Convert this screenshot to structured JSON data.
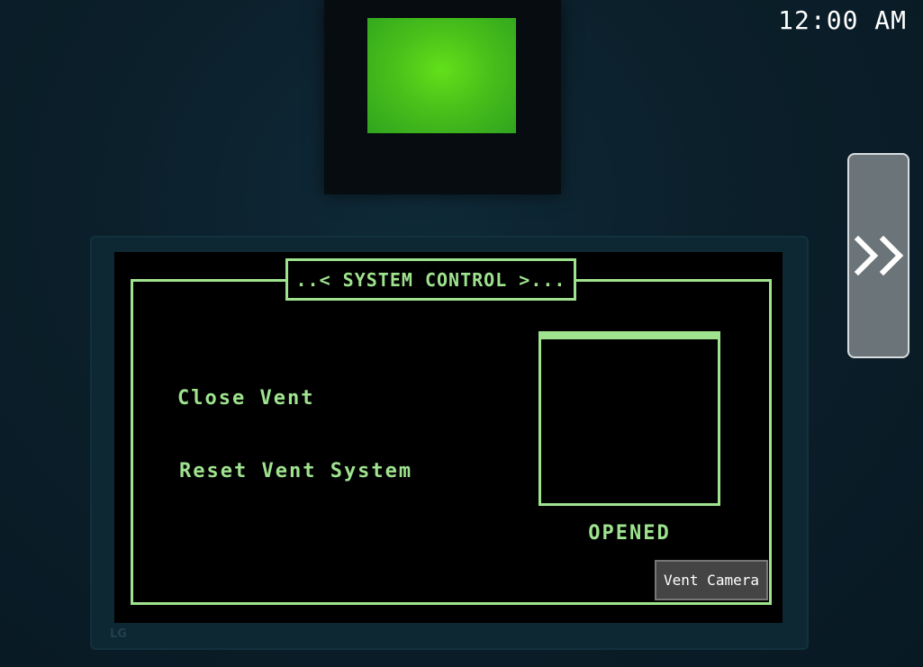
{
  "clock": {
    "time": "12:00 AM"
  },
  "side_button": {
    "label": ">>",
    "icon": "double-chevron-right-icon"
  },
  "monitor": {
    "brand": "LG"
  },
  "panel": {
    "title": "..< SYSTEM CONTROL >...",
    "menu": [
      {
        "label": "Close Vent"
      },
      {
        "label": "Reset Vent System"
      }
    ],
    "vent_status": "OPENED",
    "vent_camera_label": "Vent Camera"
  },
  "colors": {
    "terminal_green": "#9fe38f",
    "light_green": "#62e01a",
    "background": "#0b1f2a"
  }
}
